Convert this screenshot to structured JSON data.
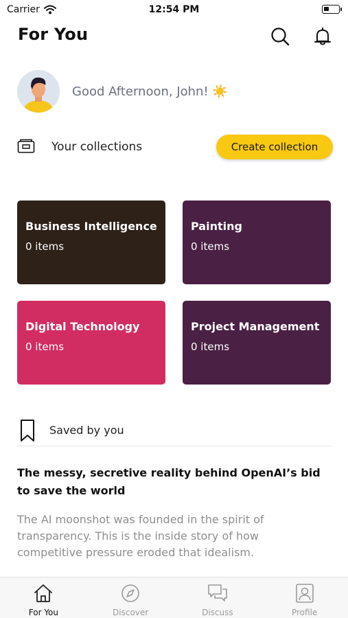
{
  "status_bar": {
    "carrier": "Carrier",
    "time": "12:54 PM",
    "battery_level": 0.35
  },
  "header": {
    "title": "For You",
    "search_icon": "search-icon",
    "notification_icon": "bell-icon"
  },
  "greeting": {
    "text": "Good Afternoon, John! ☀️"
  },
  "collections": {
    "label": "Your collections",
    "create_button": "Create collection",
    "items": [
      {
        "title": "Business Intelligence",
        "count": "0 items",
        "color": "#2e2118"
      },
      {
        "title": "Painting",
        "count": "0 items",
        "color": "#4a2044"
      },
      {
        "title": "Digital Technology",
        "count": "0 items",
        "color": "#d12d62"
      },
      {
        "title": "Project Management",
        "count": "0 items",
        "color": "#4a2044"
      }
    ]
  },
  "saved": {
    "label": "Saved by you",
    "article": {
      "title": "The messy, secretive reality behind OpenAI’s bid to save the world",
      "description": "The AI moonshot was founded in the spirit of transparency. This is the inside story of how competitive pressure eroded that idealism."
    }
  },
  "tab_bar": {
    "tabs": [
      {
        "label": "For You",
        "icon": "home-icon",
        "active": true
      },
      {
        "label": "Discover",
        "icon": "compass-icon",
        "active": false
      },
      {
        "label": "Discuss",
        "icon": "chat-icon",
        "active": false
      },
      {
        "label": "Profile",
        "icon": "profile-icon",
        "active": false
      }
    ]
  },
  "colors": {
    "accent": "#f9c811",
    "text_muted": "#8e8e8e"
  }
}
